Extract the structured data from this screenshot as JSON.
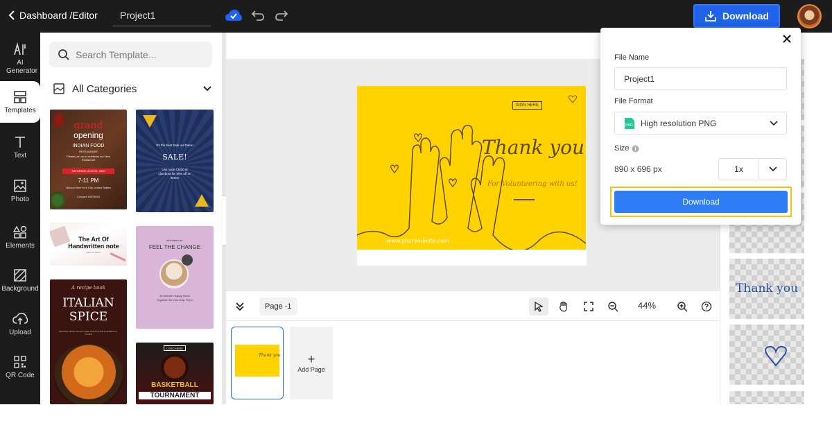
{
  "header": {
    "breadcrumb": "Dashboard /Editor",
    "project_name": "Project1",
    "download_label": "Download"
  },
  "rail": {
    "items": [
      {
        "label": "AI Generator",
        "icon": "ai-icon"
      },
      {
        "label": "Templates",
        "icon": "templates-icon",
        "active": true
      },
      {
        "label": "Text",
        "icon": "text-icon"
      },
      {
        "label": "Photo",
        "icon": "photo-icon"
      },
      {
        "label": "Elements",
        "icon": "elements-icon"
      },
      {
        "label": "Background",
        "icon": "background-icon"
      },
      {
        "label": "Upload",
        "icon": "upload-icon"
      },
      {
        "label": "QR Code",
        "icon": "qr-code-icon"
      }
    ]
  },
  "panel": {
    "search_placeholder": "Search Template...",
    "category": "All Categories",
    "templates": [
      {
        "title_a": "grand",
        "title_b": "opening",
        "sub": "INDIAN FOOD",
        "sub2": "RESTAURANT",
        "body": "Please join us to celebrate our New Restaurant",
        "date": "SATURDAY, AUG 23, 2022",
        "time": "7-11 PM",
        "place": "Nelson New York City, United States",
        "contact": "Contact 19876543"
      },
      {
        "tagline": "It's the best Sale out there!",
        "title": "SALE!",
        "body": "Use code CM30 at checkout for 30% off on items!"
      },
      {
        "title": "The Art Of Handwritten note",
        "sub": "TEXT IN GRAY"
      },
      {
        "small": "let's listen for",
        "title": "FEEL THE CHANGE",
        "body": "An animal's happy home Together We Can Help Them"
      },
      {
        "kicker": "A recipe book",
        "title_a": "ITALIAN",
        "title_b": "SPICE",
        "body": "RECIPES FROM ITALIAN CHEF AND AUTHOR ELIZABETH A. COHEN"
      },
      {
        "badge": "LOGO HERE",
        "title_a": "BASKETBALL",
        "title_b": "TOURNAMENT"
      }
    ]
  },
  "canvas": {
    "sign_here": "SIGN HERE",
    "thank_you": "Thank you",
    "volunteer": "For Volunteering with us!",
    "url": "www.yourwebsite.com"
  },
  "toolbar": {
    "page_label": "Page -1",
    "zoom": "44%",
    "add_page": "Add Page"
  },
  "right_panel": {
    "thank_you_text": "Thank you"
  },
  "download_popup": {
    "file_name_label": "File Name",
    "file_name_value": "Project1",
    "file_format_label": "File Format",
    "file_format_value": "High resolution PNG",
    "format_badge": "PNG",
    "size_label": "Size",
    "size_value": "890 x 696 px",
    "scale_value": "1x",
    "button_label": "Download"
  },
  "colors": {
    "accent": "#1e63e9",
    "download_button": "#2e7cf6",
    "highlight_border": "#f0c419",
    "canvas_yellow": "#ffd200",
    "topbar": "#1c1c1c"
  }
}
